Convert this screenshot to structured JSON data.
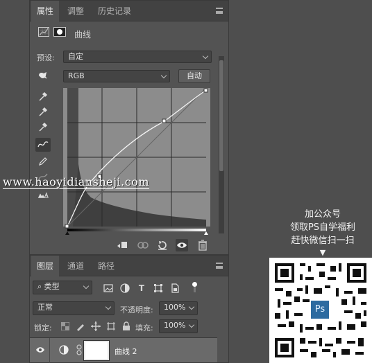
{
  "properties_panel": {
    "tabs": [
      "属性",
      "调整",
      "历史记录"
    ],
    "header_title": "曲线",
    "preset_label": "预设:",
    "preset_value": "自定",
    "channel_value": "RGB",
    "auto_button": "自动"
  },
  "layers_panel": {
    "tabs": [
      "图层",
      "通道",
      "路径"
    ],
    "filter_kind": "类型",
    "blend_mode": "正常",
    "opacity_label": "不透明度:",
    "opacity_value": "100%",
    "lock_label": "锁定:",
    "fill_label": "填充:",
    "fill_value": "100%",
    "layer_name": "曲线 2"
  },
  "watermark": "www.haoyidianshejі.com",
  "promo": {
    "line1": "加公众号",
    "line2": "领取PS自学福利",
    "line3": "赶快微信扫一扫",
    "arrow": "▼",
    "qr_badge": "Ps"
  },
  "colors": {
    "panel_bg": "#535353",
    "tab_bar_bg": "#424242",
    "app_bg": "#4e4e4e",
    "ps_badge": "#2c6aa0"
  },
  "icons": [
    "curves-adjustment-icon",
    "mask-icon",
    "eyedropper-icon",
    "curve-point-icon",
    "pencil-icon",
    "eye-icon",
    "trash-icon",
    "search-icon"
  ]
}
